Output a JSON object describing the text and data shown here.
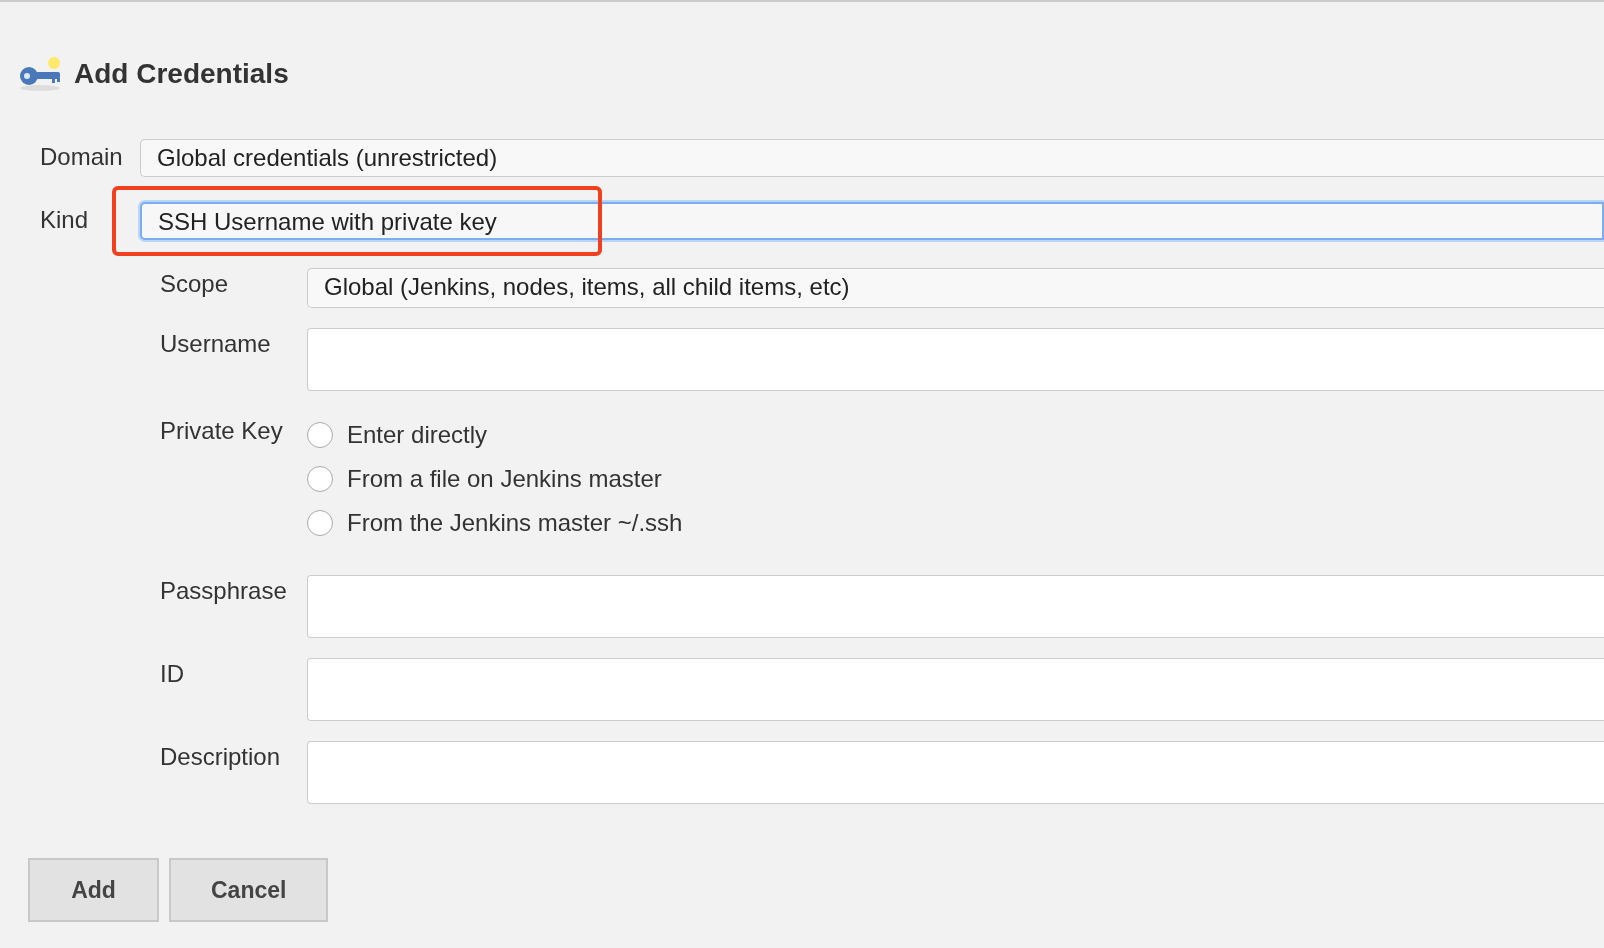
{
  "title": "Add Credentials",
  "domain": {
    "label": "Domain",
    "value": "Global credentials (unrestricted)"
  },
  "kind": {
    "label": "Kind",
    "value": "SSH Username with private key",
    "highlighted": true
  },
  "scope": {
    "label": "Scope",
    "value": "Global (Jenkins, nodes, items, all child items, etc)"
  },
  "username": {
    "label": "Username"
  },
  "private_key": {
    "label": "Private Key",
    "options": [
      {
        "label": "Enter directly",
        "selected": false
      },
      {
        "label": "From a file on Jenkins master",
        "selected": false
      },
      {
        "label": "From the Jenkins master ~/.ssh",
        "selected": false
      }
    ]
  },
  "fields": [
    {
      "label": "Passphrase"
    },
    {
      "label": "ID"
    },
    {
      "label": "Description"
    }
  ],
  "buttons": [
    "Add",
    "Cancel"
  ]
}
